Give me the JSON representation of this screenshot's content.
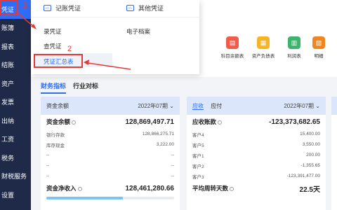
{
  "sidebar": {
    "items": [
      {
        "label": "凭证"
      },
      {
        "label": "账簿"
      },
      {
        "label": "报表"
      },
      {
        "label": "结账"
      },
      {
        "label": "资产"
      },
      {
        "label": "发票"
      },
      {
        "label": "出纳"
      },
      {
        "label": "工资"
      },
      {
        "label": "税务"
      },
      {
        "label": "财税服务"
      },
      {
        "label": "设置"
      }
    ]
  },
  "annotations": {
    "step1": "1",
    "step2": "2"
  },
  "dropdown": {
    "col1_title": "记账凭证",
    "col2_title": "其他凭证",
    "items_col1": [
      "录凭证",
      "查凭证",
      "凭证汇总表"
    ],
    "items_col2": [
      "电子档案"
    ]
  },
  "quick_entries": [
    {
      "label": "科目余额表",
      "icon": "ledger-icon",
      "color": "#f25b4a"
    },
    {
      "label": "资产负债表",
      "icon": "balance-sheet-icon",
      "color": "#f5b326"
    },
    {
      "label": "利润表",
      "icon": "profit-icon",
      "color": "#3ab56b"
    },
    {
      "label": "明细",
      "icon": "detail-icon",
      "color": "#f0861f"
    }
  ],
  "tabs": {
    "finance": "财务指标",
    "industry": "行业对标"
  },
  "card1": {
    "title": "资金余额",
    "period": "2022年07期",
    "main_label": "资金余额",
    "main_value": "128,869,497.71",
    "rows": [
      {
        "label": "银行存款",
        "value": "128,866,275.71"
      },
      {
        "label": "库存现金",
        "value": "3,222.00"
      },
      {
        "label": "--",
        "value": "--"
      },
      {
        "label": "--",
        "value": "--"
      },
      {
        "label": "--",
        "value": "--"
      }
    ],
    "net_label": "资金净收入",
    "net_value": "128,461,280.66",
    "net_progress": 0.6
  },
  "card2": {
    "tab_receivable": "应收",
    "tab_payable": "应付",
    "period": "2022年07期",
    "main_label": "应收账款",
    "main_value": "-123,373,682.65",
    "rows": [
      {
        "label": "客户4",
        "value": "15,400.00"
      },
      {
        "label": "客户5",
        "value": "3,550.00"
      },
      {
        "label": "客户1",
        "value": "200.00"
      },
      {
        "label": "客户2",
        "value": "-1,355.65"
      },
      {
        "label": "客户3",
        "value": "-123,391,477.00"
      }
    ],
    "turnover_label": "平均周转天数",
    "turnover_value": "22.5天"
  }
}
